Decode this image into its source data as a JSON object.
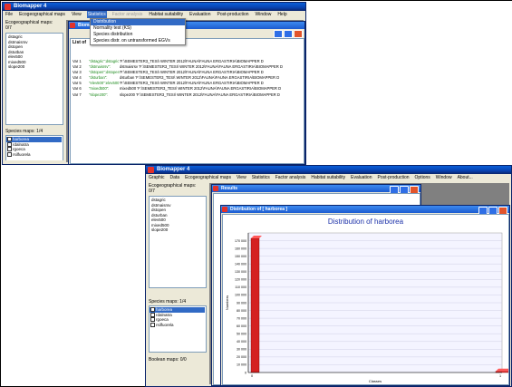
{
  "window_title": "Biomapper 4",
  "top": {
    "menu": [
      "File",
      "Ecogeographical maps",
      "View",
      "Statistics",
      "Factor analysis",
      "Habitat suitability",
      "Evaluation",
      "Post-production",
      "Window",
      "Help"
    ],
    "active_menu": "Statistics",
    "dropdown": [
      "Distribution",
      "Normality test (KS)",
      "Species distribution",
      "Species distr. on untransformed EGVs"
    ],
    "ecogeo_label": "Ecogeographical maps: 0/7",
    "ecogeo_maps": [
      "dstagric",
      "dstmaisrsv",
      "dstopen",
      "dstutban",
      "elev500",
      "mixed500",
      "slope200"
    ],
    "species_label": "Species maps: 1/4",
    "species_maps": [
      "harborea",
      "rdalnatra",
      "rgoeca",
      "rsilfuorela"
    ],
    "child_title": "Biomapper",
    "list_header": "List of",
    "var_rows": [
      {
        "id": "Var 1",
        "name": "\"dstagric\":dstagric",
        "path": "'F:\\SEMESTER3_TESI\\ WINTER 2012\\FAUNA\\FAUNA ERGASTIRIA\\BIOMAPPER D"
      },
      {
        "id": "Var 2",
        "name": "\"dstmaisrsv\":",
        "path": "dstmaisrsv    'F:\\SEMESTER3_TESI\\ WINTER 2012\\FAUNA\\FAUNA ERGASTIRIA\\BIOMAPPER D"
      },
      {
        "id": "Var 3",
        "name": "\"dstopen\":dstopen",
        "path": "'F:\\SEMESTER3_TESI\\ WINTER 2012\\FAUNA\\FAUNA ERGASTIRIA\\BIOMAPPER D"
      },
      {
        "id": "Var 4",
        "name": "\"dsturban\":",
        "path": "dsturban 'F:\\SEMESTER3_TESI\\ WINTER 2012\\FAUNA\\FAUNA ERGASTIRIA\\BIOMAPPER D"
      },
      {
        "id": "Var 5",
        "name": "\"elev500\":elev500",
        "path": "'F:\\SEMESTER3_TESI\\ WINTER 2012\\FAUNA\\FAUNA ERGASTIRIA\\BIOMAPPER D"
      },
      {
        "id": "Var 6",
        "name": "\"mixed500\":",
        "path": "mixed500 'F:\\SEMESTER3_TESI\\ WINTER 2012\\FAUNA\\FAUNA ERGASTIRIA\\BIOMAPPER D"
      },
      {
        "id": "Var 7",
        "name": "\"slope200\":",
        "path": "slope200 'F:\\SEMESTER3_TESI\\ WINTER 2012\\FAUNA\\FAUNA ERGASTIRIA\\BIOMAPPER D"
      }
    ]
  },
  "bottom": {
    "menu": [
      "Graphic",
      "Data",
      "Ecogeographical maps",
      "View",
      "Statistics",
      "Factor analysis",
      "Habitat suitability",
      "Evaluation",
      "Post-production",
      "Options",
      "Window",
      "About..."
    ],
    "ecogeo_label": "Ecogeographical maps: 0/7",
    "ecogeo_maps": [
      "dstagric",
      "dstmaisrsv",
      "dstopen",
      "dsturban",
      "elev500",
      "mixed500",
      "slope200"
    ],
    "species_label": "Species maps: 1/4",
    "species_maps": [
      "harborea",
      "rdalnatra",
      "rgoeca",
      "rsilfuorela"
    ],
    "boolean_label": "Boolean maps: 0/0",
    "results_title": "Results",
    "dist_window_title": "Distribution of [ harborea ]"
  },
  "chart_data": {
    "type": "bar",
    "title": "Distribution of harborea",
    "xlabel": "Classes",
    "ylabel": "Numbers",
    "categories": [
      "0",
      "1"
    ],
    "values": [
      173000,
      1500
    ],
    "x_ticks": [
      "0",
      "1"
    ],
    "ylim": [
      0,
      180000
    ],
    "y_ticks": [
      "0",
      "10 000",
      "20 000",
      "30 000",
      "40 000",
      "50 000",
      "60 000",
      "70 000",
      "80 000",
      "90 000",
      "100 000",
      "110 000",
      "120 000",
      "130 000",
      "140 000",
      "150 000",
      "160 000",
      "170 000"
    ],
    "bar_color": "#d42020",
    "grid": true,
    "legend": "none"
  }
}
